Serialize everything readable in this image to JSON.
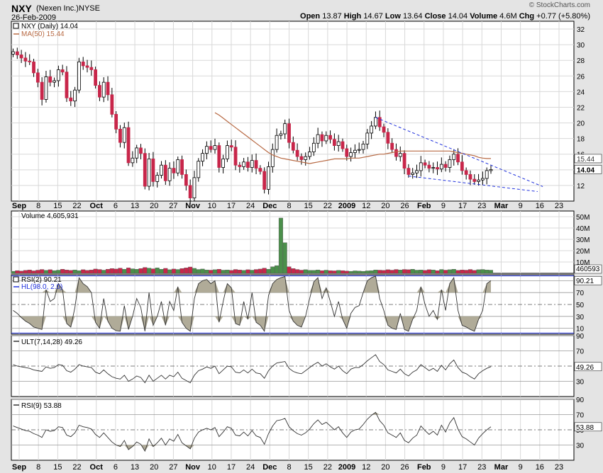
{
  "header": {
    "ticker": "NXY",
    "company": "(Nexen Inc.)",
    "exchange": "NYSE",
    "date": "26-Feb-2009",
    "brand": "© StockCharts.com",
    "open_label": "Open",
    "open": "13.87",
    "high_label": "High",
    "high": "14.67",
    "low_label": "Low",
    "low": "13.64",
    "close_label": "Close",
    "close": "14.04",
    "volume_label": "Volume",
    "volume": "4.6M",
    "chg_label": "Chg",
    "chg": "+0.77 (+5.80%)"
  },
  "colors": {
    "up": "#4a8f4a",
    "down": "#c8264a",
    "ma": "#b86a44",
    "trend": "#2233dd",
    "rsi_fill": "#b0ab98",
    "panel_bg": "#ffffff"
  },
  "chart_data": [
    {
      "type": "candlestick",
      "title": "NXY (Daily) 14.04",
      "legend": [
        "NXY (Daily) 14.04",
        "MA(50) 15.44"
      ],
      "ylim": [
        10,
        33
      ],
      "y_ticks": [
        12,
        14,
        16,
        18,
        20,
        22,
        24,
        26,
        28,
        30,
        32
      ],
      "price_labels": [
        "15.44",
        "14.04"
      ],
      "x_labels": [
        "Sep",
        "8",
        "15",
        "22",
        "Oct",
        "6",
        "13",
        "20",
        "27",
        "Nov",
        "10",
        "17",
        "24",
        "Dec",
        "8",
        "15",
        "22",
        "2009",
        "12",
        "20",
        "26",
        "Feb",
        "9",
        "17",
        "23",
        "Mar",
        "9",
        "16",
        "23"
      ],
      "close": [
        29.1,
        28.7,
        28.3,
        27.9,
        27.8,
        26.4,
        25.2,
        23.0,
        25.9,
        25.2,
        25.4,
        26.8,
        26.5,
        23.2,
        22.8,
        24.2,
        27.8,
        27.3,
        27.1,
        26.8,
        24.8,
        23.3,
        25.2,
        23.6,
        21.1,
        19.2,
        17.5,
        19.4,
        14.9,
        15.5,
        16.8,
        16.1,
        11.9,
        15.4,
        12.5,
        13.3,
        14.6,
        12.6,
        14.2,
        13.6,
        15.3,
        13.4,
        12.0,
        10.4,
        13.0,
        15.1,
        16.1,
        17.0,
        16.6,
        17.1,
        14.3,
        15.4,
        17.1,
        16.9,
        14.6,
        14.4,
        15.0,
        14.3,
        15.2,
        14.2,
        13.8,
        11.5,
        14.4,
        16.6,
        18.4,
        18.6,
        19.9,
        17.5,
        16.5,
        15.7,
        15.3,
        15.7,
        16.3,
        17.4,
        18.5,
        17.7,
        18.4,
        17.9,
        17.1,
        17.6,
        16.7,
        15.7,
        16.2,
        16.5,
        16.6,
        17.3,
        18.7,
        19.6,
        20.7,
        19.5,
        18.8,
        17.4,
        16.6,
        15.7,
        16.1,
        14.2,
        13.4,
        13.6,
        13.9,
        14.9,
        14.6,
        14.2,
        14.3,
        14.1,
        14.7,
        14.3,
        15.3,
        16.0,
        15.0,
        13.9,
        13.4,
        12.8,
        12.5,
        12.7,
        12.9,
        13.9,
        14.04
      ],
      "ma50": [
        null,
        null,
        null,
        null,
        null,
        null,
        null,
        null,
        null,
        null,
        null,
        null,
        null,
        null,
        null,
        null,
        null,
        null,
        null,
        null,
        null,
        null,
        null,
        null,
        null,
        null,
        null,
        null,
        null,
        null,
        null,
        null,
        null,
        null,
        null,
        null,
        null,
        null,
        null,
        null,
        null,
        null,
        null,
        null,
        null,
        null,
        null,
        null,
        null,
        21.3,
        21.0,
        20.6,
        20.2,
        19.8,
        19.4,
        19.0,
        18.6,
        18.2,
        17.8,
        17.4,
        17.0,
        16.6,
        16.2,
        15.9,
        15.7,
        15.5,
        15.4,
        15.3,
        15.2,
        15.1,
        15.0,
        14.9,
        14.8,
        14.9,
        15.0,
        15.1,
        15.2,
        15.3,
        15.4,
        15.4,
        15.4,
        15.4,
        15.5,
        15.5,
        15.5,
        15.6,
        15.7,
        15.8,
        15.9,
        16.0,
        16.0,
        16.1,
        16.2,
        16.3,
        16.4,
        16.4,
        16.4,
        16.4,
        16.4,
        16.4,
        16.4,
        16.4,
        16.4,
        16.4,
        16.4,
        16.4,
        16.4,
        16.3,
        16.2,
        16.1,
        16.0,
        15.9,
        15.8,
        15.6,
        15.5,
        15.44,
        15.44
      ]
    },
    {
      "type": "bar",
      "title": "Volume 4,605,931",
      "ylim": [
        0,
        55
      ],
      "y_ticks_labels": [
        "10M",
        "20M",
        "30M",
        "40M",
        "50M"
      ],
      "y_ticks": [
        10,
        20,
        30,
        40,
        50
      ],
      "value_label": "460593",
      "values": [
        1.8,
        2.4,
        2.0,
        2.6,
        3.0,
        2.2,
        2.8,
        3.4,
        2.6,
        3.2,
        2.4,
        2.8,
        3.6,
        3.0,
        2.6,
        3.0,
        2.4,
        3.2,
        2.6,
        3.0,
        3.8,
        3.4,
        2.8,
        3.6,
        4.2,
        3.8,
        4.6,
        3.6,
        4.8,
        4.0,
        3.6,
        4.2,
        5.2,
        4.6,
        4.0,
        4.8,
        3.6,
        4.4,
        3.2,
        3.8,
        3.4,
        4.2,
        4.8,
        5.6,
        4.4,
        3.4,
        3.8,
        3.0,
        2.8,
        3.2,
        3.6,
        2.8,
        3.0,
        2.6,
        3.4,
        3.0,
        2.6,
        3.2,
        2.8,
        3.4,
        3.8,
        4.6,
        3.6,
        5.8,
        6.8,
        48.8,
        27.0,
        5.8,
        4.2,
        3.4,
        2.8,
        3.2,
        2.6,
        2.6,
        3.0,
        2.4,
        2.8,
        2.4,
        2.2,
        2.6,
        2.4,
        2.0,
        1.8,
        2.2,
        2.0,
        1.8,
        2.2,
        2.4,
        3.0,
        2.8,
        2.6,
        3.2,
        2.8,
        3.4,
        3.0,
        3.4,
        3.2,
        3.6,
        2.8,
        3.0,
        2.6,
        3.2,
        3.0,
        2.4,
        3.4,
        2.8,
        3.2,
        3.6,
        2.6,
        3.0,
        2.8,
        3.4,
        2.6,
        3.2,
        3.4,
        3.0,
        2.8
      ]
    },
    {
      "type": "line",
      "title": "RSI(2) 90.21",
      "legend": [
        "RSI(2) 90.21",
        "HL(98.0, 2.0)"
      ],
      "ylim": [
        0,
        100
      ],
      "y_ticks": [
        10,
        30,
        50,
        70,
        90
      ],
      "value_label": "90.21",
      "values": [
        40,
        35,
        28,
        22,
        18,
        12,
        10,
        8,
        75,
        55,
        60,
        85,
        75,
        18,
        12,
        45,
        95,
        85,
        80,
        70,
        20,
        10,
        60,
        22,
        10,
        6,
        5,
        48,
        8,
        30,
        60,
        45,
        5,
        70,
        15,
        30,
        55,
        15,
        55,
        40,
        80,
        20,
        10,
        5,
        60,
        85,
        90,
        92,
        85,
        90,
        20,
        55,
        85,
        78,
        18,
        15,
        55,
        25,
        70,
        20,
        15,
        5,
        65,
        85,
        92,
        95,
        97,
        40,
        22,
        15,
        12,
        30,
        60,
        88,
        95,
        60,
        78,
        55,
        30,
        55,
        25,
        10,
        35,
        45,
        48,
        70,
        90,
        95,
        98,
        60,
        40,
        15,
        10,
        8,
        35,
        8,
        5,
        25,
        40,
        80,
        50,
        30,
        40,
        25,
        75,
        40,
        85,
        95,
        40,
        15,
        12,
        8,
        5,
        25,
        40,
        85,
        90.21
      ]
    },
    {
      "type": "line",
      "title": "ULT(7,14,28) 49.26",
      "ylim": [
        10,
        90
      ],
      "y_ticks": [
        30,
        50,
        70,
        90
      ],
      "value_label": "49.26",
      "values": [
        52,
        50,
        49,
        48,
        47,
        45,
        44,
        43,
        49,
        47,
        48,
        52,
        51,
        44,
        42,
        46,
        52,
        50,
        49,
        48,
        42,
        40,
        45,
        40,
        36,
        34,
        33,
        38,
        30,
        33,
        37,
        35,
        28,
        38,
        30,
        34,
        38,
        33,
        38,
        36,
        42,
        34,
        31,
        28,
        38,
        44,
        46,
        49,
        47,
        50,
        40,
        45,
        50,
        49,
        42,
        41,
        45,
        41,
        46,
        41,
        40,
        34,
        44,
        50,
        54,
        55,
        56,
        47,
        43,
        41,
        40,
        44,
        48,
        52,
        55,
        50,
        53,
        49,
        46,
        50,
        44,
        40,
        46,
        48,
        48,
        52,
        57,
        61,
        65,
        56,
        52,
        45,
        43,
        41,
        46,
        40,
        37,
        42,
        45,
        52,
        48,
        44,
        47,
        43,
        51,
        45,
        53,
        58,
        48,
        42,
        40,
        36,
        33,
        40,
        44,
        47,
        49.26
      ]
    },
    {
      "type": "line",
      "title": "RSI(9) 53.88",
      "ylim": [
        10,
        90
      ],
      "y_ticks": [
        30,
        50,
        70,
        90
      ],
      "value_label": "53.88",
      "values": [
        55,
        53,
        51,
        49,
        48,
        45,
        43,
        40,
        50,
        48,
        49,
        54,
        53,
        43,
        41,
        46,
        56,
        54,
        53,
        51,
        44,
        40,
        46,
        40,
        34,
        30,
        28,
        36,
        24,
        28,
        34,
        31,
        22,
        38,
        28,
        33,
        39,
        30,
        38,
        35,
        44,
        33,
        29,
        25,
        39,
        47,
        50,
        52,
        50,
        53,
        41,
        47,
        54,
        52,
        43,
        42,
        47,
        42,
        49,
        42,
        40,
        31,
        45,
        55,
        62,
        63,
        65,
        54,
        49,
        45,
        43,
        46,
        51,
        58,
        63,
        57,
        60,
        55,
        50,
        54,
        46,
        40,
        47,
        50,
        51,
        57,
        64,
        69,
        73,
        62,
        56,
        46,
        43,
        40,
        46,
        36,
        33,
        39,
        43,
        55,
        49,
        44,
        48,
        43,
        56,
        47,
        59,
        66,
        51,
        41,
        38,
        34,
        30,
        39,
        45,
        50,
        53.88
      ]
    }
  ]
}
